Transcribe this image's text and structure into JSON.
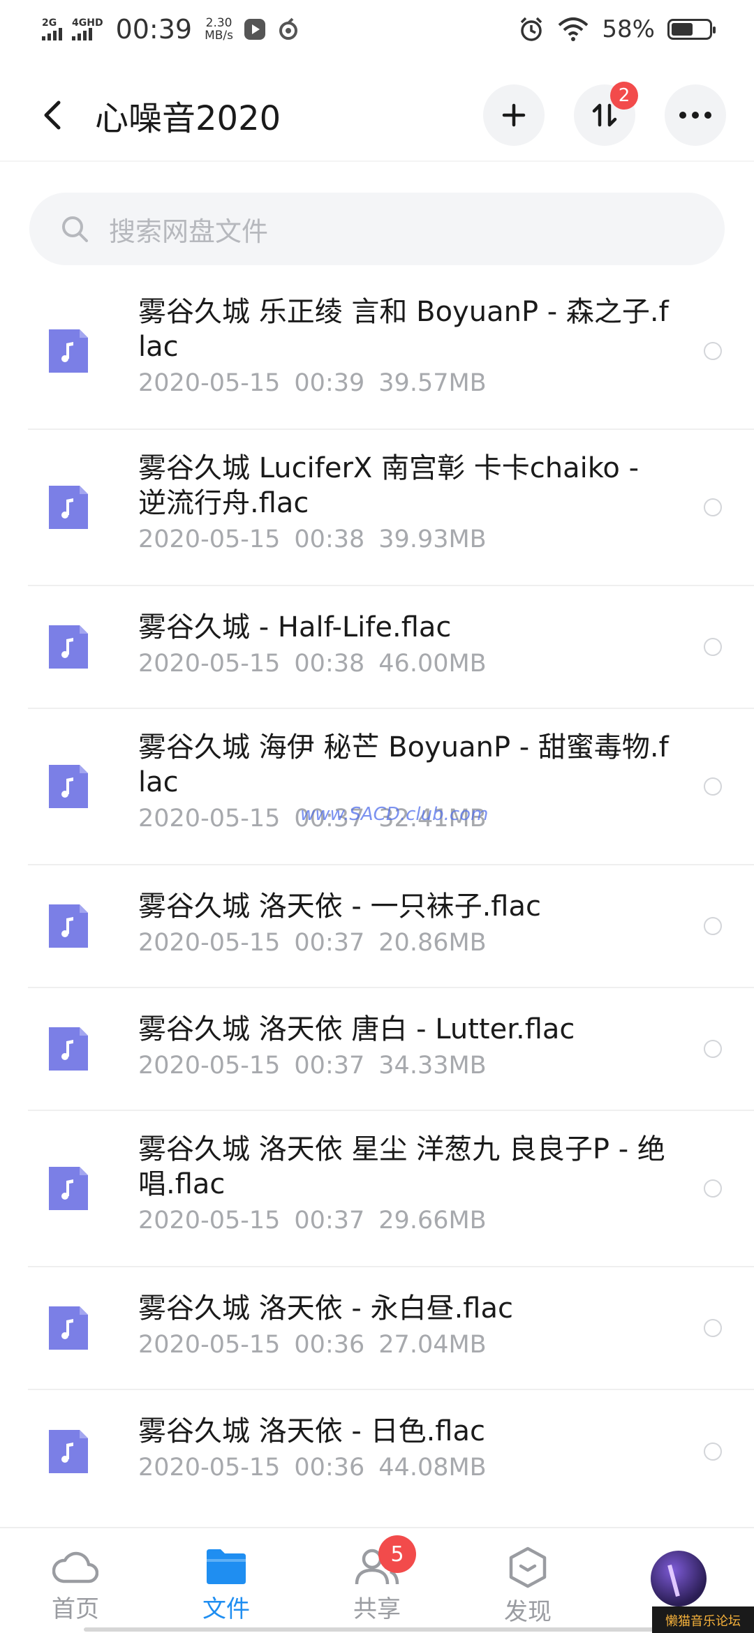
{
  "status_bar": {
    "net1": "2G",
    "net2": "4GHD",
    "time": "00:39",
    "speed_value": "2.30",
    "speed_unit": "MB/s",
    "battery_percent": "58%",
    "battery_level": 0.58
  },
  "header": {
    "title": "心噪音2020",
    "transfer_badge": "2"
  },
  "search": {
    "placeholder": "搜索网盘文件"
  },
  "files": [
    {
      "name": "雾谷久城 乐正绫 言和 BoyuanP - 森之子.flac",
      "date": "2020-05-15",
      "time": "00:39",
      "size": "39.57MB"
    },
    {
      "name": "雾谷久城 LuciferX 南宫彰 卡卡chaiko - 逆流行舟.flac",
      "date": "2020-05-15",
      "time": "00:38",
      "size": "39.93MB"
    },
    {
      "name": "雾谷久城 - Half-Life.flac",
      "date": "2020-05-15",
      "time": "00:38",
      "size": "46.00MB"
    },
    {
      "name": "雾谷久城 海伊 秘芒 BoyuanP - 甜蜜毒物.flac",
      "date": "2020-05-15",
      "time": "00:37",
      "size": "32.41MB"
    },
    {
      "name": "雾谷久城 洛天依 - 一只袜子.flac",
      "date": "2020-05-15",
      "time": "00:37",
      "size": "20.86MB"
    },
    {
      "name": "雾谷久城 洛天依 唐白 - Lutter.flac",
      "date": "2020-05-15",
      "time": "00:37",
      "size": "34.33MB"
    },
    {
      "name": "雾谷久城 洛天依 星尘 洋葱九 良良子P - 绝唱.flac",
      "date": "2020-05-15",
      "time": "00:37",
      "size": "29.66MB"
    },
    {
      "name": "雾谷久城 洛天依 - 永白昼.flac",
      "date": "2020-05-15",
      "time": "00:36",
      "size": "27.04MB"
    },
    {
      "name": "雾谷久城 洛天依 - 日色.flac",
      "date": "2020-05-15",
      "time": "00:36",
      "size": "44.08MB"
    }
  ],
  "watermark": "www.SACD.club.com",
  "bottom_nav": {
    "home": "首页",
    "files": "文件",
    "share": "共享",
    "share_badge": "5",
    "discover": "发现"
  },
  "corner_logo": "懒猫音乐论坛",
  "colors": {
    "accent": "#1f8ef1",
    "file_icon": "#7b7fe6",
    "badge": "#f24b4b"
  }
}
